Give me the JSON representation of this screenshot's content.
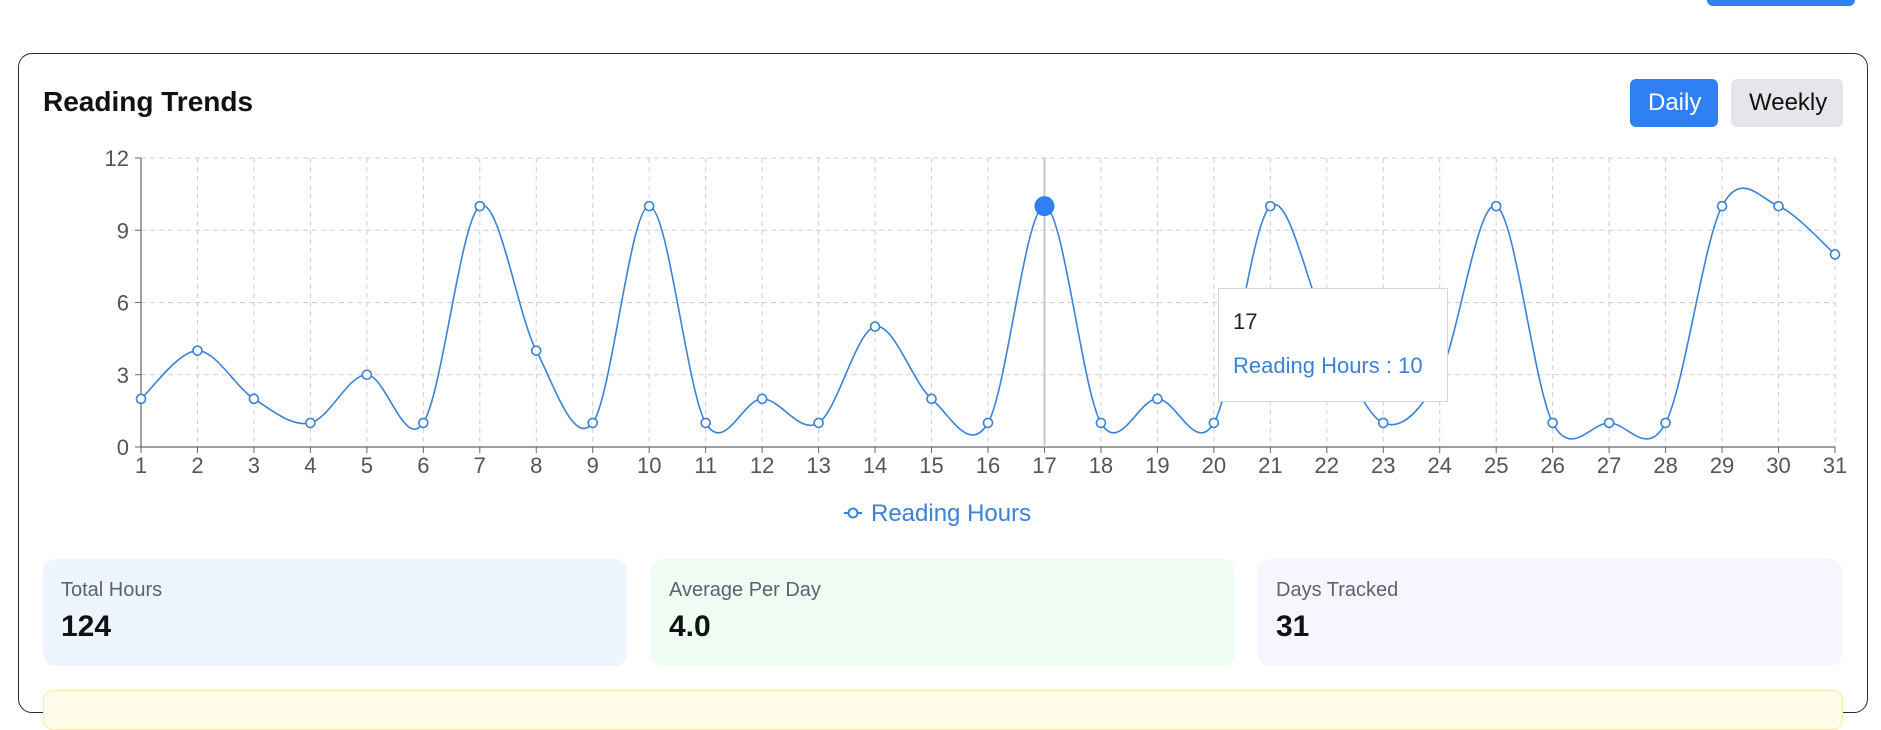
{
  "card": {
    "title": "Reading Trends"
  },
  "toggles": {
    "daily": "Daily",
    "weekly": "Weekly",
    "active": "daily"
  },
  "colors": {
    "accent": "#2f80f5",
    "line": "#3b82d6"
  },
  "chart_data": {
    "type": "line",
    "x": [
      1,
      2,
      3,
      4,
      5,
      6,
      7,
      8,
      9,
      10,
      11,
      12,
      13,
      14,
      15,
      16,
      17,
      18,
      19,
      20,
      21,
      22,
      23,
      24,
      25,
      26,
      27,
      28,
      29,
      30,
      31
    ],
    "series": [
      {
        "name": "Reading Hours",
        "values": [
          2,
          4,
          2,
          1,
          3,
          1,
          10,
          4,
          1,
          10,
          1,
          2,
          1,
          5,
          2,
          1,
          10,
          1,
          2,
          1,
          10,
          5,
          1,
          3,
          10,
          1,
          1,
          1,
          10,
          10,
          8
        ]
      }
    ],
    "ylim": [
      0,
      12
    ],
    "yticks": [
      0,
      3,
      6,
      9,
      12
    ],
    "grid": true,
    "legend": "bottom-center",
    "highlight_index": 16
  },
  "tooltip": {
    "label": "17",
    "value_text": "Reading Hours : 10"
  },
  "stats": [
    {
      "label": "Total Hours",
      "value": "124"
    },
    {
      "label": "Average Per Day",
      "value": "4.0"
    },
    {
      "label": "Days Tracked",
      "value": "31"
    }
  ]
}
